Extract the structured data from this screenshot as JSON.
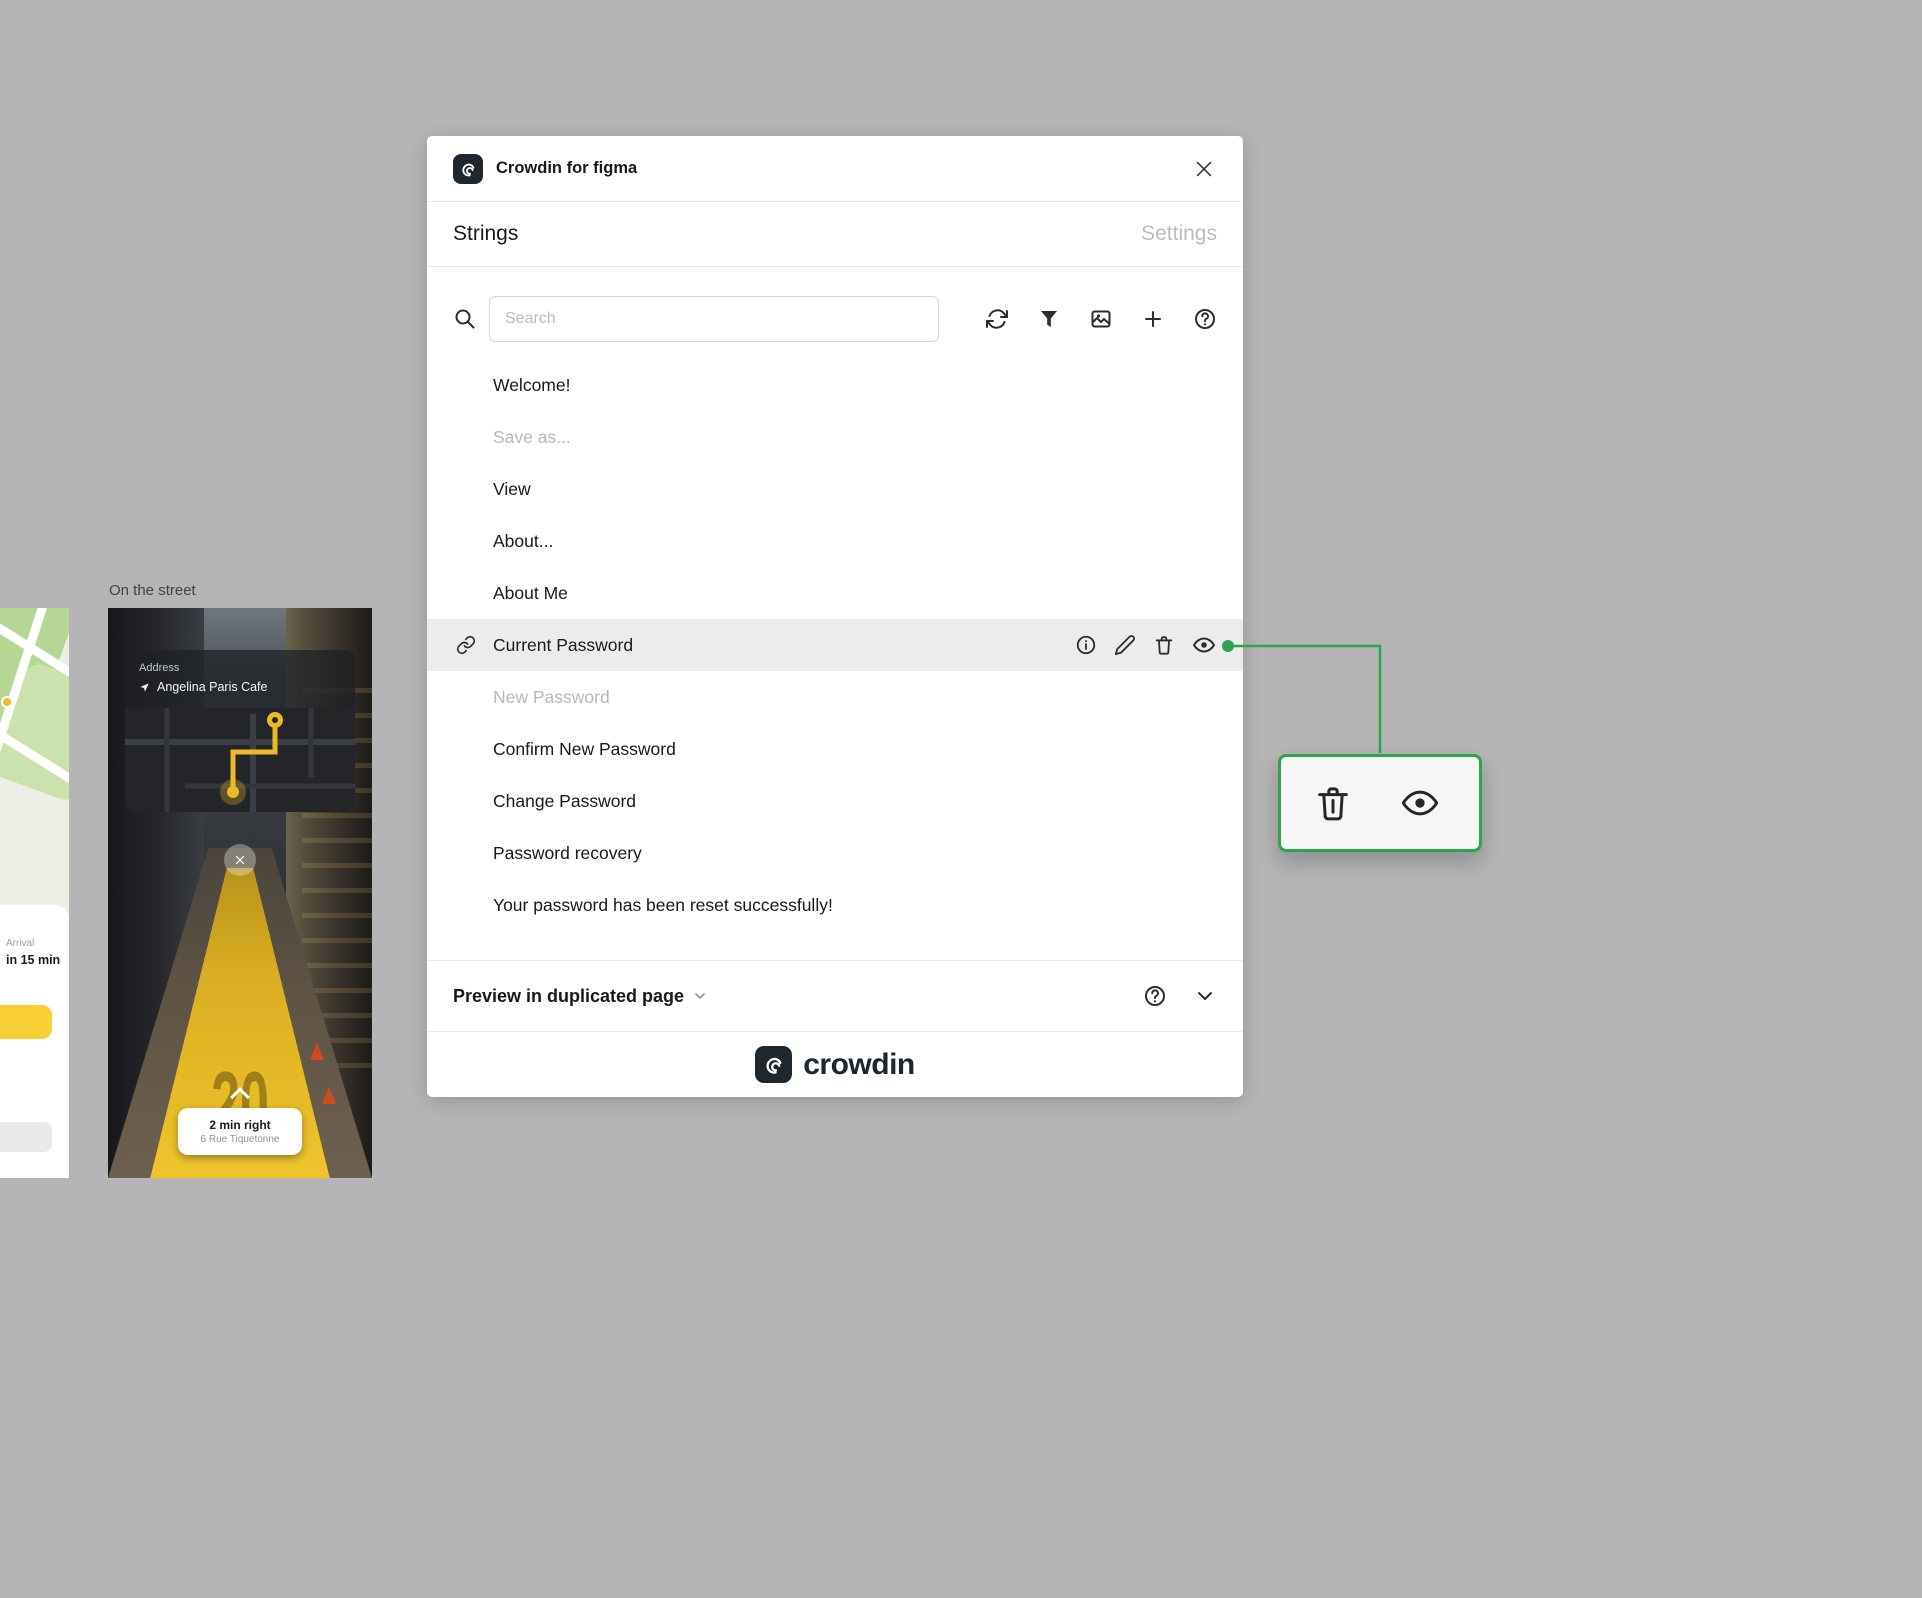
{
  "window": {
    "title": "Crowdin for figma",
    "tabs": {
      "strings": "Strings",
      "settings": "Settings"
    },
    "search": {
      "placeholder": "Search"
    },
    "strings_list": [
      {
        "label": "Welcome!",
        "state": "default"
      },
      {
        "label": "Save as...",
        "state": "muted"
      },
      {
        "label": "View",
        "state": "default"
      },
      {
        "label": "About...",
        "state": "default"
      },
      {
        "label": "About Me",
        "state": "default"
      },
      {
        "label": "Current Password",
        "state": "selected"
      },
      {
        "label": "New Password",
        "state": "muted"
      },
      {
        "label": "Confirm New Password",
        "state": "default"
      },
      {
        "label": "Change Password",
        "state": "default"
      },
      {
        "label": "Password recovery",
        "state": "default"
      },
      {
        "label": "Your password has been reset successfully!",
        "state": "default"
      }
    ],
    "selected_row_actions": [
      "info-icon",
      "edit-icon",
      "delete-icon",
      "preview-icon"
    ],
    "toolbar_icons": [
      "search-icon",
      "sync-icon",
      "filter-icon",
      "image-icon",
      "add-icon",
      "help-icon"
    ],
    "footer": {
      "preview_label": "Preview in duplicated page"
    },
    "brand_wordmark": "crowdin"
  },
  "callout": {
    "icons": [
      "delete-icon",
      "preview-icon"
    ],
    "border_color": "#2da44e"
  },
  "colors": {
    "canvas": "#b5b5b5",
    "accent_green": "#2da44e",
    "selected_row": "#ececec",
    "muted_text": "#b8b8b8",
    "text": "#17191c",
    "logo_dark": "#20262e"
  },
  "artboards": {
    "street": {
      "title": "On the street",
      "card": {
        "label": "Address",
        "value": "Angelina Paris Cafe"
      },
      "road_marking": "20",
      "direction": {
        "primary": "2 min right",
        "secondary": "6 Rue Tiquetonne"
      }
    },
    "map": {
      "arrival_label": "Arrival",
      "arrival_value": "in 15 min"
    }
  }
}
